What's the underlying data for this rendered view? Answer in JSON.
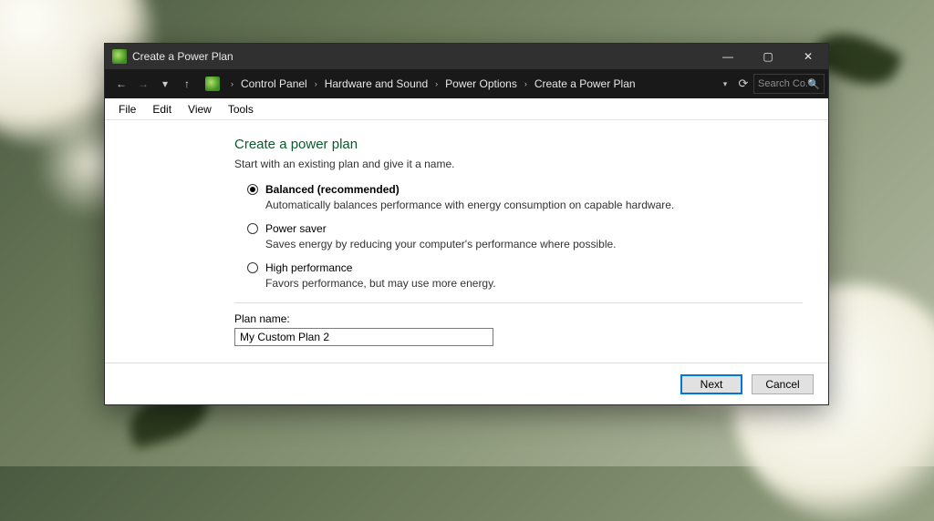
{
  "window": {
    "title": "Create a Power Plan"
  },
  "titlebar_controls": {
    "minimize": "—",
    "maximize": "▢",
    "close": "✕"
  },
  "nav": {
    "back": "←",
    "forward": "→",
    "recent_dropdown": "▾",
    "up": "↑",
    "crumb_drop": "▾",
    "refresh": "⟳"
  },
  "breadcrumbs": {
    "sep": "›",
    "items": [
      "Control Panel",
      "Hardware and Sound",
      "Power Options",
      "Create a Power Plan"
    ]
  },
  "search": {
    "placeholder": "Search Co..."
  },
  "menubar": {
    "items": [
      "File",
      "Edit",
      "View",
      "Tools"
    ]
  },
  "page": {
    "title": "Create a power plan",
    "subtitle": "Start with an existing plan and give it a name."
  },
  "options": [
    {
      "id": "balanced",
      "label": "Balanced (recommended)",
      "desc": "Automatically balances performance with energy consumption on capable hardware.",
      "selected": true
    },
    {
      "id": "power-saver",
      "label": "Power saver",
      "desc": "Saves energy by reducing your computer's performance where possible.",
      "selected": false
    },
    {
      "id": "high-performance",
      "label": "High performance",
      "desc": "Favors performance, but may use more energy.",
      "selected": false
    }
  ],
  "plan_name": {
    "label": "Plan name:",
    "value": "My Custom Plan 2"
  },
  "buttons": {
    "next": "Next",
    "cancel": "Cancel"
  }
}
